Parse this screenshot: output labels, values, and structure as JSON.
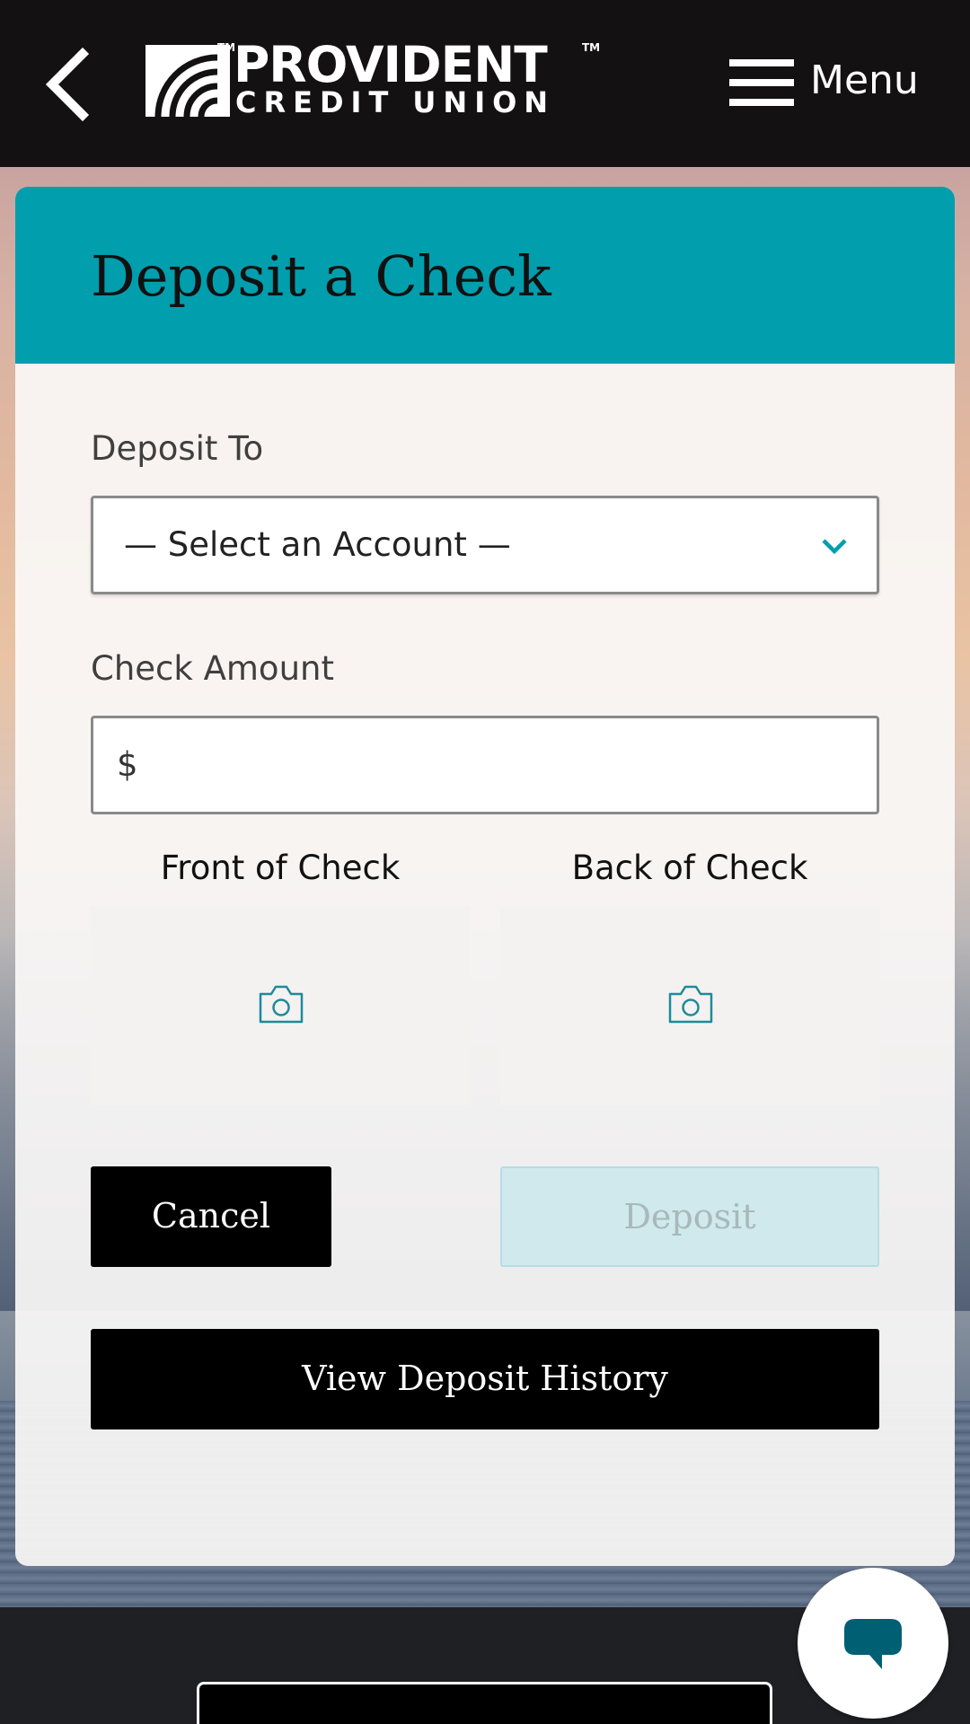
{
  "header": {
    "back_icon": "chevron-left-icon",
    "logo": {
      "line1": "PROVIDENT",
      "line2": "CREDIT UNION",
      "trademark": "TM"
    },
    "menu_icon": "hamburger-icon",
    "menu_label": "Menu"
  },
  "card": {
    "title": "Deposit a Check",
    "header_color": "#019ead",
    "deposit_to": {
      "label": "Deposit To",
      "selected": "— Select an Account —",
      "icon": "chevron-down-icon"
    },
    "check_amount": {
      "label": "Check Amount",
      "currency_symbol": "$",
      "value": ""
    },
    "front_of_check": {
      "label": "Front of Check",
      "icon": "camera-icon"
    },
    "back_of_check": {
      "label": "Back of Check",
      "icon": "camera-icon"
    },
    "buttons": {
      "cancel": "Cancel",
      "deposit": "Deposit",
      "view_history": "View Deposit History"
    }
  },
  "chat": {
    "icon": "chat-bubble-icon",
    "color": "#015f73"
  }
}
